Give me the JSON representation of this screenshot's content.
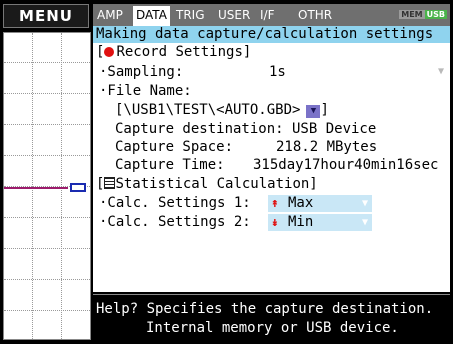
{
  "menu": {
    "label": "MENU"
  },
  "tabs": [
    {
      "label": "AMP",
      "active": false
    },
    {
      "label": "DATA",
      "active": true
    },
    {
      "label": "TRIG",
      "active": false
    },
    {
      "label": "USER",
      "active": false
    },
    {
      "label": "I/F",
      "active": false
    },
    {
      "label": "OTHR",
      "active": false
    }
  ],
  "status": {
    "mem": "MEM",
    "usb": "USB"
  },
  "panel": {
    "title": "Making data capture/calculation settings",
    "record_section": "[●Record Settings]",
    "record_section_text": "Record Settings]",
    "sampling_label": "·Sampling:",
    "sampling_value": "1s",
    "filename_label": "·File Name:",
    "filename_path": "[\\USB1\\TEST\\<AUTO.GBD>",
    "filename_close": "]",
    "capture_destination": "Capture destination: USB Device",
    "capture_space_label": "Capture Space:",
    "capture_space_value": "218.2 MBytes",
    "capture_time_label": "Capture Time:",
    "capture_time_value": "315day17hour40min16sec",
    "stat_section_open": "[",
    "stat_section_text": "Statistical Calculation]",
    "calc1_label": "·Calc. Settings 1:",
    "calc1_value": "Max",
    "calc2_label": "·Calc. Settings 2:",
    "calc2_value": "Min"
  },
  "help": {
    "line1": "Help? Specifies the capture destination.",
    "line2": "Internal memory or USB device."
  },
  "colors": {
    "title_bar": "#8fd3ee",
    "calc_combo": "#c9e7f6",
    "record_dot": "#e01010",
    "usb_badge": "#4ab34a",
    "trace": "#9c1c6c"
  },
  "icons": [
    "record-dot-icon",
    "dropdown-arrow-icon",
    "calculator-icon",
    "max-arrow-icon",
    "min-arrow-icon",
    "cursor-marker-icon"
  ]
}
